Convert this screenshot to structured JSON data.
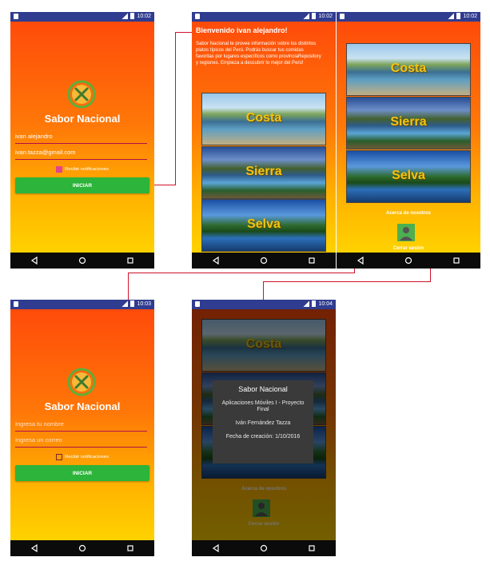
{
  "status_times": {
    "s1": "10:02",
    "s2": "10:02",
    "s3": "10:02",
    "s4": "10:03",
    "s5": "10:04"
  },
  "app_title": "Sabor Nacional",
  "login_filled": {
    "name": "ivan alejandro",
    "email": "ivan.tazza@gmail.com",
    "checkbox_label": "Recibir notificaciones",
    "button": "INICIAR"
  },
  "login_empty": {
    "name_placeholder": "Ingresa tu nombre",
    "email_placeholder": "Ingresa un correo",
    "checkbox_label": "Recibir notificaciones",
    "button": "INICIAR"
  },
  "welcome": {
    "title": "Bienvenido ivan alejandro!",
    "text": "Sabor Nacional te provee información sobre los distintos platos típicos del Perú. Podrás buscar tus comidas favoritas por lugares específicos como provinciaRepository y regiones. Empieza a descubrir lo mejor del Perú!"
  },
  "regions": [
    "Costa",
    "Sierra",
    "Selva"
  ],
  "about_label": "Acerca de nosotros",
  "logout_label": "Cerrar sesión",
  "dialog": {
    "title": "Sabor Nacional",
    "line1": "Aplicaciones Móviles I - Proyecto Final",
    "line2": "Iván Fernández Tazza",
    "line3": "Fecha de creación: 1/10/2016"
  },
  "colors": {
    "status_bar": "#2f3c8f",
    "gradient_top": "#ff4b0a",
    "gradient_bottom": "#ffd200",
    "button": "#2db43a",
    "region_label": "#f2c410",
    "connector": "#d0122a"
  }
}
